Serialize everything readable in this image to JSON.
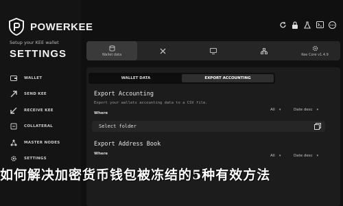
{
  "brand": {
    "name": "POWERKEE",
    "logo_icon": "shield-p-icon"
  },
  "sidebar": {
    "subtitle": "Setup your KEE wallet",
    "title": "SETTINGS",
    "items": [
      {
        "label": "WALLET",
        "icon": "wallet-icon"
      },
      {
        "label": "SEND KEE",
        "icon": "send-icon"
      },
      {
        "label": "RECEIVE KEE",
        "icon": "receive-icon"
      },
      {
        "label": "COLLATERAL",
        "icon": "collateral-icon"
      },
      {
        "label": "MASTER NODES",
        "icon": "nodes-icon"
      },
      {
        "label": "SETTINGS",
        "icon": "gear-icon"
      }
    ]
  },
  "top_icons": [
    "refresh-icon",
    "lock-icon",
    "flask-icon",
    "terminal-icon",
    "ellipsis-icon"
  ],
  "tabs": [
    {
      "label": "Wallet data",
      "icon": "database-icon",
      "active": true
    },
    {
      "label": "",
      "icon": "tools-icon"
    },
    {
      "label": "",
      "icon": "display-icon"
    },
    {
      "label": "",
      "icon": "network-icon"
    },
    {
      "label": "Kee Core v1.4.9",
      "icon": "gear-icon"
    }
  ],
  "subtabs": [
    {
      "label": "WALLET DATA",
      "active": false
    },
    {
      "label": "EXPORT ACCOUNTING",
      "active": true
    }
  ],
  "export_accounting": {
    "title": "Export Accounting",
    "description": "Export your wallets accounting data to a CSV file.",
    "where_label": "Where",
    "scope": "All",
    "sort": "Date desc",
    "folder_placeholder": "Select folder"
  },
  "export_address_book": {
    "title": "Export Address Book",
    "where_label": "Where",
    "scope": "All",
    "sort": "Date desc"
  },
  "overlay_text": "如何解决加密货币钱包被冻结的5种有效方法",
  "colors": {
    "background": "#101010",
    "panel": "#1c1c1c",
    "text": "#e6e6e6"
  }
}
